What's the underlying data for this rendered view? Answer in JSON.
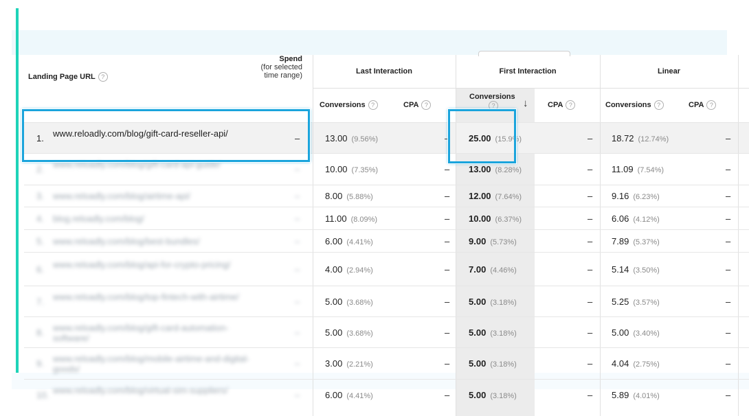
{
  "colors": {
    "accent": "#1ed3b8",
    "highlight": "#1aa4dc",
    "top_band": "#eef8fc"
  },
  "columns": {
    "landing_page": "Landing Page URL",
    "spend_label": "Spend",
    "spend_sub": "(for selected time range)",
    "groups": [
      "Last Interaction",
      "First Interaction",
      "Linear"
    ],
    "conversions": "Conversions",
    "cpa": "CPA",
    "help_icon": "?",
    "sort_icon": "↓"
  },
  "rows": [
    {
      "num": "1.",
      "url": "www.reloadly.com/blog/gift-card-reseller-api/",
      "spend": "–",
      "last_conv": "13.00",
      "last_pct": "(9.56%)",
      "last_cpa": "–",
      "first_conv": "25.00",
      "first_pct": "(15.9%)",
      "first_cpa": "–",
      "linear_conv": "18.72",
      "linear_pct": "(12.74%)",
      "linear_cpa": "–"
    },
    {
      "num": "2.",
      "url": "www.reloadly.com/blog/gift-card-api-guide/",
      "spend": "–",
      "last_conv": "10.00",
      "last_pct": "(7.35%)",
      "last_cpa": "–",
      "first_conv": "13.00",
      "first_pct": "(8.28%)",
      "first_cpa": "–",
      "linear_conv": "11.09",
      "linear_pct": "(7.54%)",
      "linear_cpa": "–"
    },
    {
      "num": "3.",
      "url": "www.reloadly.com/blog/airtime-api/",
      "spend": "–",
      "last_conv": "8.00",
      "last_pct": "(5.88%)",
      "last_cpa": "–",
      "first_conv": "12.00",
      "first_pct": "(7.64%)",
      "first_cpa": "–",
      "linear_conv": "9.16",
      "linear_pct": "(6.23%)",
      "linear_cpa": "–"
    },
    {
      "num": "4.",
      "url": "blog.reloadly.com/blog/",
      "spend": "–",
      "last_conv": "11.00",
      "last_pct": "(8.09%)",
      "last_cpa": "–",
      "first_conv": "10.00",
      "first_pct": "(6.37%)",
      "first_cpa": "–",
      "linear_conv": "6.06",
      "linear_pct": "(4.12%)",
      "linear_cpa": "–"
    },
    {
      "num": "5.",
      "url": "www.reloadly.com/blog/best-bundles/",
      "spend": "–",
      "last_conv": "6.00",
      "last_pct": "(4.41%)",
      "last_cpa": "–",
      "first_conv": "9.00",
      "first_pct": "(5.73%)",
      "first_cpa": "–",
      "linear_conv": "7.89",
      "linear_pct": "(5.37%)",
      "linear_cpa": "–"
    },
    {
      "num": "6.",
      "url": "www.reloadly.com/blog/api-for-crypto-pricing/",
      "spend": "–",
      "last_conv": "4.00",
      "last_pct": "(2.94%)",
      "last_cpa": "–",
      "first_conv": "7.00",
      "first_pct": "(4.46%)",
      "first_cpa": "–",
      "linear_conv": "5.14",
      "linear_pct": "(3.50%)",
      "linear_cpa": "–"
    },
    {
      "num": "7.",
      "url": "www.reloadly.com/blog/top-fintech-with-airtime/",
      "spend": "–",
      "last_conv": "5.00",
      "last_pct": "(3.68%)",
      "last_cpa": "–",
      "first_conv": "5.00",
      "first_pct": "(3.18%)",
      "first_cpa": "–",
      "linear_conv": "5.25",
      "linear_pct": "(3.57%)",
      "linear_cpa": "–"
    },
    {
      "num": "8.",
      "url": "www.reloadly.com/blog/gift-card-automation-software/",
      "spend": "–",
      "last_conv": "5.00",
      "last_pct": "(3.68%)",
      "last_cpa": "–",
      "first_conv": "5.00",
      "first_pct": "(3.18%)",
      "first_cpa": "–",
      "linear_conv": "5.00",
      "linear_pct": "(3.40%)",
      "linear_cpa": "–"
    },
    {
      "num": "9.",
      "url": "www.reloadly.com/blog/mobile-airtime-and-digital-goods/",
      "spend": "–",
      "last_conv": "3.00",
      "last_pct": "(2.21%)",
      "last_cpa": "–",
      "first_conv": "5.00",
      "first_pct": "(3.18%)",
      "first_cpa": "–",
      "linear_conv": "4.04",
      "linear_pct": "(2.75%)",
      "linear_cpa": "–"
    },
    {
      "num": "10.",
      "url": "www.reloadly.com/blog/virtual-sim-suppliers/",
      "spend": "–",
      "last_conv": "6.00",
      "last_pct": "(4.41%)",
      "last_cpa": "–",
      "first_conv": "5.00",
      "first_pct": "(3.18%)",
      "first_cpa": "–",
      "linear_conv": "5.89",
      "linear_pct": "(4.01%)",
      "linear_cpa": "–"
    }
  ]
}
